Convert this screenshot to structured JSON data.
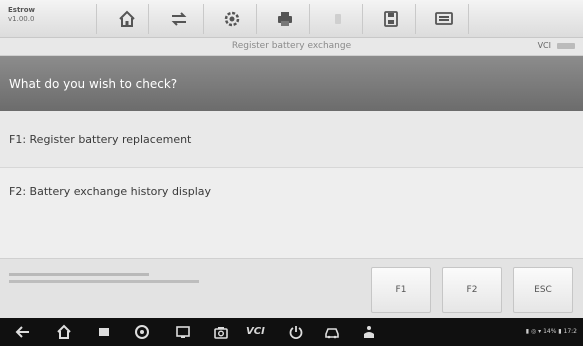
{
  "toolbar": {
    "brand_line1": "Estrow",
    "brand_line2": "v1.00.0",
    "icons": [
      "home-icon",
      "vehicle-swap-icon",
      "settings-icon",
      "print-icon",
      "help-icon",
      "save-icon",
      "data-logging-icon"
    ]
  },
  "titlebar": {
    "title": "Register battery exchange",
    "vci_label": "VCI"
  },
  "question": "What do you wish to check?",
  "options": [
    {
      "label": "F1: Register battery replacement"
    },
    {
      "label": "F2: Battery exchange history display"
    }
  ],
  "actions": {
    "buttons": [
      "F1",
      "F2",
      "ESC"
    ]
  },
  "navbar": {
    "vci_label": "VCI",
    "status_text": "▮ ◎ ▾ 14% ▮ 17:2"
  },
  "colors": {
    "question_bg": "#7c7c7c",
    "option_bg": "#e9e9e9",
    "navbar_bg": "#101010"
  }
}
